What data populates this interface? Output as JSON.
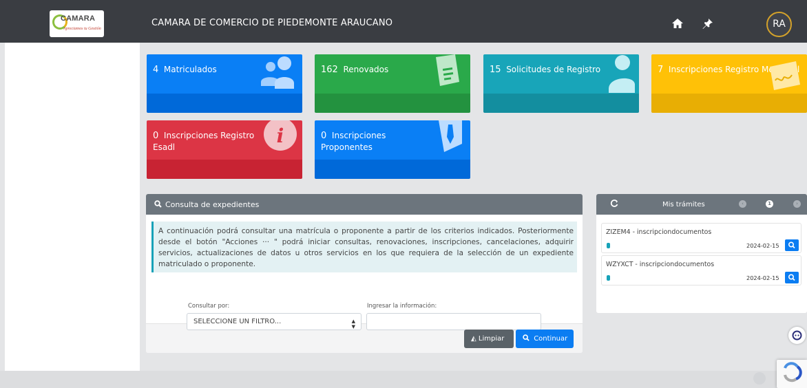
{
  "header": {
    "logo": {
      "word": "CAMARA",
      "tagline": "Apreciamos tu Gestión"
    },
    "title": "CAMARA DE COMERCIO DE PIEDEMONTE ARAUCANO",
    "avatar_initials": "RA"
  },
  "cards": [
    {
      "number": "4",
      "label": "Matriculados",
      "color": "#0a7ff5",
      "icon": "users-icon"
    },
    {
      "number": "162",
      "label": "Renovados",
      "color": "#2aa94a",
      "icon": "document-icon"
    },
    {
      "number": "15",
      "label": "Solicitudes de Registro",
      "color": "#18a5b9",
      "icon": "user-icon"
    },
    {
      "number": "7",
      "label": "Inscripciones Registro Mercantil",
      "color": "#ffc107",
      "icon": "signature-icon"
    },
    {
      "number": "0",
      "label": "Inscripciones Registro Esadl",
      "color": "#dc3545",
      "icon": "info-icon"
    },
    {
      "number": "0",
      "label": "Inscripciones Proponentes",
      "color": "#0a7ff5",
      "icon": "id-tie-icon"
    }
  ],
  "consulta": {
    "title": "Consulta de expedientes",
    "info": "A continuación podrá consultar una matrícula o proponente a partir de los criterios indicados. Posteriormente desde el botón \"Acciones ··· \" podrá iniciar consultas, renovaciones, inscripciones, cancelaciones, adquirir servicios, actualizaciones de datos u otros servicios en los que requiera de la selección de un expediente matriculado o proponente.",
    "filter_label": "Consultar por:",
    "filter_value": "SELECCIONE UN FILTRO...",
    "input_label": "Ingresar la información:",
    "input_value": "",
    "clear_label": "Limpiar",
    "continue_label": "Continuar"
  },
  "tramites": {
    "title": "Mis trámites",
    "current_page": "1",
    "items": [
      {
        "name": "ZIZEM4 - inscripciondocumentos",
        "date": "2024-02-15"
      },
      {
        "name": "WZYXCT - inscripciondocumentos",
        "date": "2024-02-15"
      }
    ]
  },
  "colors": {
    "header": "#3a3d42",
    "panel_head": "#6c757d",
    "primary": "#0b7df2",
    "info": "#17a2b8"
  }
}
